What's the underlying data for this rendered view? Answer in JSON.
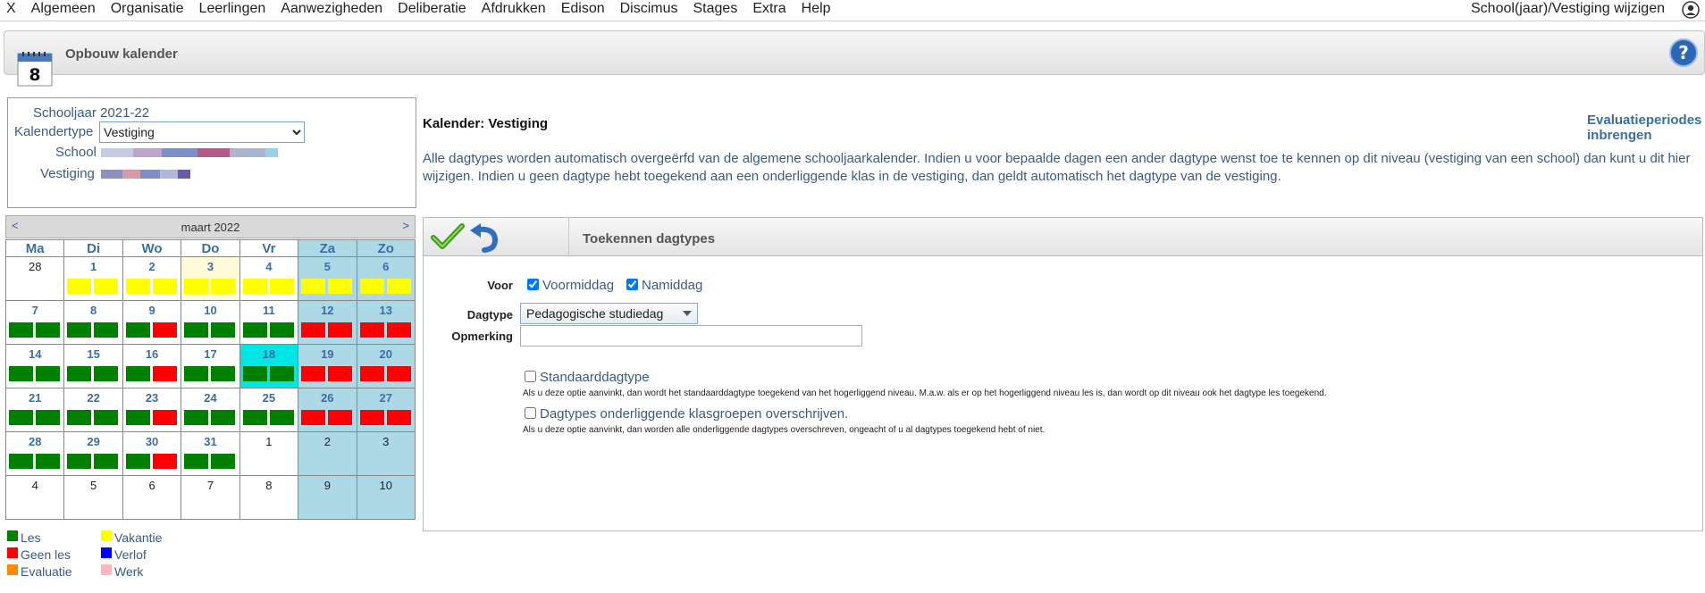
{
  "menu": {
    "items": [
      "X",
      "Algemeen",
      "Organisatie",
      "Leerlingen",
      "Aanwezigheden",
      "Deliberatie",
      "Afdrukken",
      "Edison",
      "Discimus",
      "Stages",
      "Extra",
      "Help"
    ],
    "right_label": "School(jaar)/Vestiging wijzigen"
  },
  "header": {
    "title": "Opbouw kalender",
    "calendar_icon_day": "8"
  },
  "info": {
    "schooljaar": "Schooljaar 2021-22",
    "kalendertype_label": "Kalendertype",
    "kalendertype_value": "Vestiging",
    "school_label": "School",
    "vestiging_label": "Vestiging"
  },
  "calendar": {
    "prev": "<",
    "next": ">",
    "month": "maart 2022",
    "weekdays": [
      "Ma",
      "Di",
      "Wo",
      "Do",
      "Vr",
      "Za",
      "Zo"
    ],
    "weeks": [
      [
        {
          "d": "28",
          "cur": false,
          "bars": []
        },
        {
          "d": "1",
          "cur": true,
          "bars": [
            "vak",
            "vak"
          ]
        },
        {
          "d": "2",
          "cur": true,
          "bars": [
            "vak",
            "vak"
          ]
        },
        {
          "d": "3",
          "cur": true,
          "bars": [
            "vak",
            "vak"
          ],
          "hl": true
        },
        {
          "d": "4",
          "cur": true,
          "bars": [
            "vak",
            "vak"
          ]
        },
        {
          "d": "5",
          "cur": true,
          "bars": [
            "vak",
            "vak"
          ]
        },
        {
          "d": "6",
          "cur": true,
          "bars": [
            "vak",
            "vak"
          ]
        }
      ],
      [
        {
          "d": "7",
          "cur": true,
          "bars": [
            "les",
            "les"
          ]
        },
        {
          "d": "8",
          "cur": true,
          "bars": [
            "les",
            "les"
          ]
        },
        {
          "d": "9",
          "cur": true,
          "bars": [
            "les",
            "geen"
          ]
        },
        {
          "d": "10",
          "cur": true,
          "bars": [
            "les",
            "les"
          ]
        },
        {
          "d": "11",
          "cur": true,
          "bars": [
            "les",
            "les"
          ]
        },
        {
          "d": "12",
          "cur": true,
          "bars": [
            "geen",
            "geen"
          ]
        },
        {
          "d": "13",
          "cur": true,
          "bars": [
            "geen",
            "geen"
          ]
        }
      ],
      [
        {
          "d": "14",
          "cur": true,
          "bars": [
            "les",
            "les"
          ]
        },
        {
          "d": "15",
          "cur": true,
          "bars": [
            "les",
            "les"
          ]
        },
        {
          "d": "16",
          "cur": true,
          "bars": [
            "les",
            "geen"
          ]
        },
        {
          "d": "17",
          "cur": true,
          "bars": [
            "les",
            "les"
          ]
        },
        {
          "d": "18",
          "cur": true,
          "bars": [
            "les",
            "les"
          ],
          "today": true
        },
        {
          "d": "19",
          "cur": true,
          "bars": [
            "geen",
            "geen"
          ]
        },
        {
          "d": "20",
          "cur": true,
          "bars": [
            "geen",
            "geen"
          ]
        }
      ],
      [
        {
          "d": "21",
          "cur": true,
          "bars": [
            "les",
            "les"
          ]
        },
        {
          "d": "22",
          "cur": true,
          "bars": [
            "les",
            "les"
          ]
        },
        {
          "d": "23",
          "cur": true,
          "bars": [
            "les",
            "geen"
          ]
        },
        {
          "d": "24",
          "cur": true,
          "bars": [
            "les",
            "les"
          ]
        },
        {
          "d": "25",
          "cur": true,
          "bars": [
            "les",
            "les"
          ]
        },
        {
          "d": "26",
          "cur": true,
          "bars": [
            "geen",
            "geen"
          ]
        },
        {
          "d": "27",
          "cur": true,
          "bars": [
            "geen",
            "geen"
          ]
        }
      ],
      [
        {
          "d": "28",
          "cur": true,
          "bars": [
            "les",
            "les"
          ]
        },
        {
          "d": "29",
          "cur": true,
          "bars": [
            "les",
            "les"
          ]
        },
        {
          "d": "30",
          "cur": true,
          "bars": [
            "les",
            "geen"
          ]
        },
        {
          "d": "31",
          "cur": true,
          "bars": [
            "les",
            "les"
          ]
        },
        {
          "d": "1",
          "cur": false,
          "bars": []
        },
        {
          "d": "2",
          "cur": false,
          "bars": []
        },
        {
          "d": "3",
          "cur": false,
          "bars": []
        }
      ],
      [
        {
          "d": "4",
          "cur": false,
          "bars": []
        },
        {
          "d": "5",
          "cur": false,
          "bars": []
        },
        {
          "d": "6",
          "cur": false,
          "bars": []
        },
        {
          "d": "7",
          "cur": false,
          "bars": []
        },
        {
          "d": "8",
          "cur": false,
          "bars": []
        },
        {
          "d": "9",
          "cur": false,
          "bars": []
        },
        {
          "d": "10",
          "cur": false,
          "bars": []
        }
      ]
    ]
  },
  "legend": [
    {
      "label": "Les",
      "color": "#008000"
    },
    {
      "label": "Vakantie",
      "color": "#ffff00"
    },
    {
      "label": "Geen les",
      "color": "#ff0000"
    },
    {
      "label": "Verlof",
      "color": "#0000ff"
    },
    {
      "label": "Evaluatie",
      "color": "#ff8c00"
    },
    {
      "label": "Werk",
      "color": "#ffb6c1"
    }
  ],
  "main": {
    "title": "Kalender: Vestiging",
    "evaluatie_link": "Evaluatieperiodes inbrengen",
    "description": "Alle dagtypes worden automatisch overgeërfd van de algemene schooljaarkalender. Indien u voor bepaalde dagen een ander dagtype wenst toe te kennen op dit niveau (vestiging van een school) dan kunt u dit hier wijzigen. Indien u geen dagtype hebt toegekend aan een onderliggende klas in de vestiging, dan geldt automatisch het dagtype van de vestiging."
  },
  "panel": {
    "title": "Toekennen dagtypes",
    "voor_label": "Voor",
    "voormiddag": "Voormiddag",
    "namiddag": "Namiddag",
    "dagtype_label": "Dagtype",
    "dagtype_value": "Pedagogische studiedag",
    "opmerking_label": "Opmerking",
    "opmerking_value": "",
    "standaard_label": "Standaarddagtype",
    "standaard_help": "Als u deze optie aanvinkt, dan wordt het standaarddagtype toegekend van het hogerliggend niveau. M.a.w. als er op het hogerliggend niveau les is, dan wordt op dit niveau ook het dagtype les toegekend.",
    "overschrijven_label": "Dagtypes onderliggende klasgroepen overschrijven.",
    "overschrijven_help": "Als u deze optie aanvinkt, dan worden alle onderliggende dagtypes overschreven, ongeacht of u al dagtypes toegekend hebt of niet."
  }
}
